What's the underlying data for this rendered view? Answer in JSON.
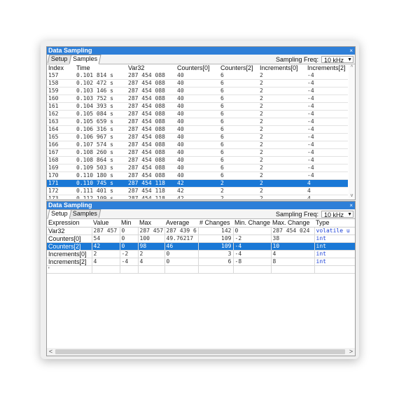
{
  "panel1": {
    "title": "Data Sampling",
    "close": "×",
    "tabs": [
      "Setup",
      "Samples"
    ],
    "sampling_label": "Sampling Freq:",
    "sampling_value": "10 kHz",
    "columns": [
      "Index",
      "Time",
      "Var32",
      "Counters[0]",
      "Counters[2]",
      "Increments[0]",
      "Increments[2]"
    ],
    "rows": [
      {
        "index": "157",
        "time": "0.101 814 s",
        "var32": "287 454 088",
        "c0": "40",
        "c2": "6",
        "i0": "2",
        "i2": "-4"
      },
      {
        "index": "158",
        "time": "0.102 472 s",
        "var32": "287 454 088",
        "c0": "40",
        "c2": "6",
        "i0": "2",
        "i2": "-4"
      },
      {
        "index": "159",
        "time": "0.103 146 s",
        "var32": "287 454 088",
        "c0": "40",
        "c2": "6",
        "i0": "2",
        "i2": "-4"
      },
      {
        "index": "160",
        "time": "0.103 752 s",
        "var32": "287 454 088",
        "c0": "40",
        "c2": "6",
        "i0": "2",
        "i2": "-4"
      },
      {
        "index": "161",
        "time": "0.104 393 s",
        "var32": "287 454 088",
        "c0": "40",
        "c2": "6",
        "i0": "2",
        "i2": "-4"
      },
      {
        "index": "162",
        "time": "0.105 084 s",
        "var32": "287 454 088",
        "c0": "40",
        "c2": "6",
        "i0": "2",
        "i2": "-4"
      },
      {
        "index": "163",
        "time": "0.105 659 s",
        "var32": "287 454 088",
        "c0": "40",
        "c2": "6",
        "i0": "2",
        "i2": "-4"
      },
      {
        "index": "164",
        "time": "0.106 316 s",
        "var32": "287 454 088",
        "c0": "40",
        "c2": "6",
        "i0": "2",
        "i2": "-4"
      },
      {
        "index": "165",
        "time": "0.106 967 s",
        "var32": "287 454 088",
        "c0": "40",
        "c2": "6",
        "i0": "2",
        "i2": "-4"
      },
      {
        "index": "166",
        "time": "0.107 574 s",
        "var32": "287 454 088",
        "c0": "40",
        "c2": "6",
        "i0": "2",
        "i2": "-4"
      },
      {
        "index": "167",
        "time": "0.108 260 s",
        "var32": "287 454 088",
        "c0": "40",
        "c2": "6",
        "i0": "2",
        "i2": "-4"
      },
      {
        "index": "168",
        "time": "0.108 864 s",
        "var32": "287 454 088",
        "c0": "40",
        "c2": "6",
        "i0": "2",
        "i2": "-4"
      },
      {
        "index": "169",
        "time": "0.109 503 s",
        "var32": "287 454 088",
        "c0": "40",
        "c2": "6",
        "i0": "2",
        "i2": "-4"
      },
      {
        "index": "170",
        "time": "0.110 180 s",
        "var32": "287 454 088",
        "c0": "40",
        "c2": "6",
        "i0": "2",
        "i2": "-4"
      },
      {
        "index": "171",
        "time": "0.110 745 s",
        "var32": "287 454 118",
        "c0": "42",
        "c2": "2",
        "i0": "2",
        "i2": "4",
        "selected": true
      },
      {
        "index": "172",
        "time": "0.111 401 s",
        "var32": "287 454 118",
        "c0": "42",
        "c2": "2",
        "i0": "2",
        "i2": "4"
      },
      {
        "index": "173",
        "time": "0.112 109 s",
        "var32": "287 454 118",
        "c0": "42",
        "c2": "2",
        "i0": "2",
        "i2": "4"
      }
    ],
    "scroll_up": "^",
    "scroll_down": "v"
  },
  "panel2": {
    "title": "Data Sampling",
    "close": "×",
    "tabs": [
      "Setup",
      "Samples"
    ],
    "sampling_label": "Sampling Freq:",
    "sampling_value": "10 kHz",
    "columns": [
      "Expression",
      "Value",
      "Min",
      "Max",
      "Average",
      "# Changes",
      "Min. Change",
      "Max. Change",
      "Type"
    ],
    "rows": [
      {
        "expr": "Var32",
        "value": "287 457 0",
        "min": "0",
        "max": "287 457",
        "avg": "287 439 6",
        "changes": "142",
        "minch": "0",
        "maxch": "287 454 024",
        "type": "volatile u"
      },
      {
        "expr": "Counters[0]",
        "value": "54",
        "min": "0",
        "max": "100",
        "avg": "49.76217",
        "changes": "109",
        "minch": "-2",
        "maxch": "38",
        "type": "int"
      },
      {
        "expr": "Counters[2]",
        "value": "42",
        "min": "0",
        "max": "98",
        "avg": "46",
        "changes": "109",
        "minch": "-4",
        "maxch": "10",
        "type": "int",
        "selected": true
      },
      {
        "expr": "Increments[0]",
        "value": "2",
        "min": "-2",
        "max": "2",
        "avg": "0",
        "changes": "3",
        "minch": "-4",
        "maxch": "4",
        "type": "int"
      },
      {
        "expr": "Increments[2]",
        "value": "4",
        "min": "-4",
        "max": "4",
        "avg": "0",
        "changes": "6",
        "minch": "-8",
        "maxch": "8",
        "type": "int"
      },
      {
        "expr": "'",
        "value": "",
        "min": "",
        "max": "",
        "avg": "",
        "changes": "",
        "minch": "",
        "maxch": "",
        "type": ""
      }
    ],
    "scroll_left": "<",
    "scroll_right": ">"
  },
  "colors": {
    "titlebar": "#2e7fd8",
    "selection": "#1a78d6",
    "type_text": "#1a3fd6"
  }
}
